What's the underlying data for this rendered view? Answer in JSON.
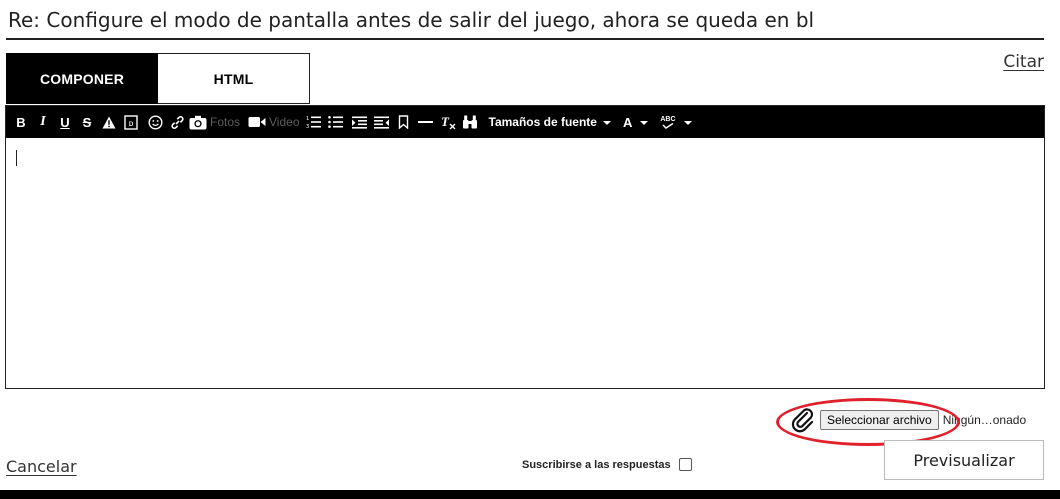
{
  "subject": {
    "value": "Re: Configure el modo de pantalla antes de salir del juego, ahora se queda en bl"
  },
  "tabs": [
    {
      "label": "COMPONER",
      "active": true
    },
    {
      "label": "HTML",
      "active": false
    }
  ],
  "cite_label": "Citar",
  "toolbar": {
    "bold": "B",
    "italic": "I",
    "underline": "U",
    "strike": "S",
    "photos_label": "Fotos",
    "video_label": "Video",
    "font_size_label": "Tamaños de fuente",
    "font_color_label": "A",
    "spellcheck_label": "ABC"
  },
  "attachment": {
    "button_label": "Seleccionar archivo",
    "status": "Ningún…onado"
  },
  "footer": {
    "cancel_label": "Cancelar",
    "subscribe_label": "Suscribirse a las respuestas",
    "subscribe_checked": false,
    "preview_label": "Previsualizar"
  },
  "colors": {
    "toolbar_bg": "#000000",
    "active_tab_bg": "#000000",
    "highlight": "#e0202b"
  },
  "icons": [
    "warning-icon",
    "spoiler-icon",
    "emoji-icon",
    "link-icon",
    "camera-icon",
    "video-icon",
    "ordered-list-icon",
    "bullet-list-icon",
    "indent-icon",
    "outdent-icon",
    "bookmark-icon",
    "horizontal-rule-icon",
    "clear-format-icon",
    "find-icon",
    "paperclip-icon"
  ]
}
